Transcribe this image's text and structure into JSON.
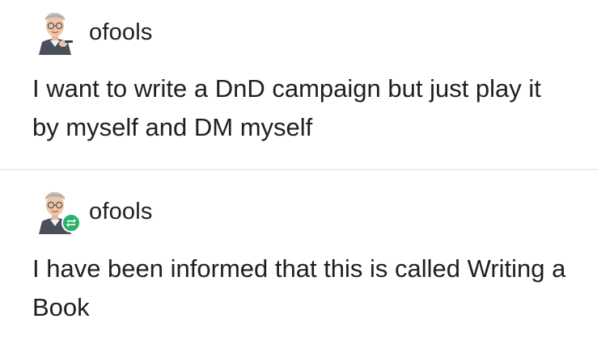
{
  "posts": [
    {
      "username": "ofools",
      "text": "I want to write a DnD campaign but just play it by myself and DM myself",
      "reblogged": false
    },
    {
      "username": "ofools",
      "text": "I have been informed that this is called Writing a Book",
      "reblogged": true
    }
  ],
  "icons": {
    "avatar": "avatar-illustration-icon",
    "reblog": "reblog-icon"
  },
  "colors": {
    "background": "#ffffff",
    "text": "#1f1f1f",
    "divider": "#ececec",
    "reblog_badge": "#29b36a"
  }
}
